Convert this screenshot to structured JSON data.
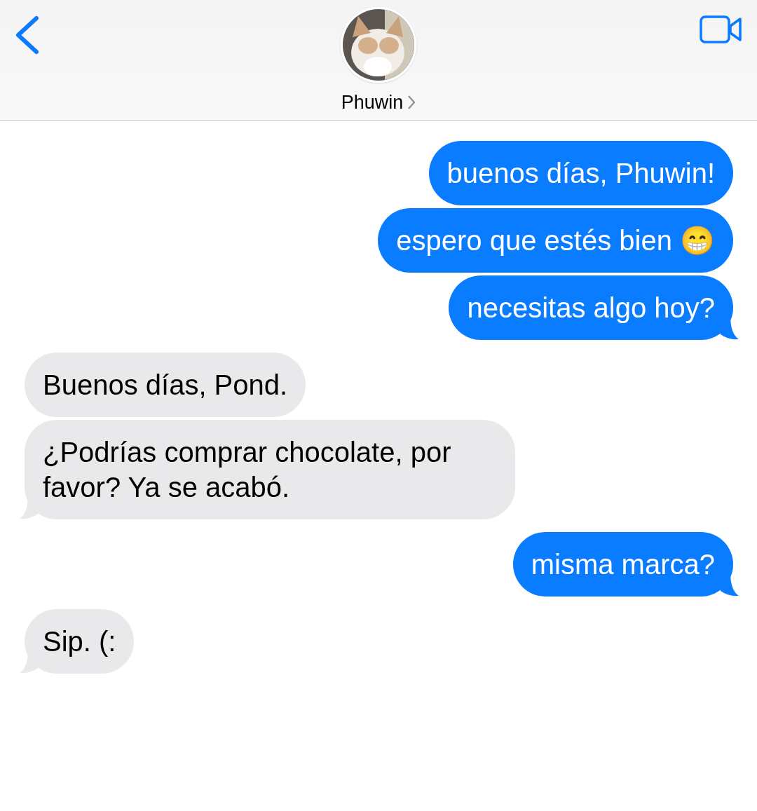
{
  "header": {
    "contact_name": "Phuwin"
  },
  "messages": [
    {
      "kind": "sent",
      "text": "buenos días, Phuwin!",
      "tail": false
    },
    {
      "kind": "sent",
      "text": "espero que estés bien 😁",
      "tail": false
    },
    {
      "kind": "sent",
      "text": "necesitas algo hoy?",
      "tail": true
    },
    {
      "kind": "received",
      "text": "Buenos días, Pond.",
      "tail": false
    },
    {
      "kind": "received",
      "text": "¿Podrías comprar chocolate, por favor? Ya se acabó.",
      "tail": true
    },
    {
      "kind": "sent",
      "text": "misma marca?",
      "tail": true
    },
    {
      "kind": "received",
      "text": "Sip. (:",
      "tail": true
    }
  ]
}
